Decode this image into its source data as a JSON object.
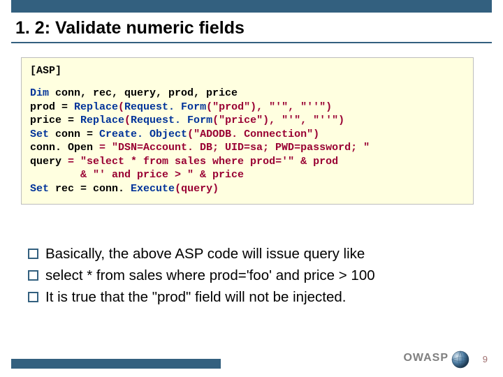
{
  "title": "1. 2: Validate numeric fields",
  "code_tag": "[ASP]",
  "code": {
    "l1": {
      "kw": "Dim ",
      "rest": "conn, rec, query, prod, price"
    },
    "l2": {
      "id": "prod = ",
      "fn": "Replace",
      "p1": "(",
      "fn2": "Request. Form",
      "p2": "(\"prod\"), \"'\", \"''\")"
    },
    "l3": {
      "id": "price = ",
      "fn": "Replace",
      "p1": "(",
      "fn2": "Request. Form",
      "p2": "(\"price\"), \"'\", \"''\")"
    },
    "l4": {
      "kw": "Set ",
      "id": "conn = ",
      "fn": "Create. Object",
      "p": "(\"ADODB. Connection\")"
    },
    "l5": {
      "id": "conn. Open",
      "p": " = \"DSN=Account. DB; UID=sa; PWD=password; \""
    },
    "l6": {
      "id": "query",
      "p": " = \"select * from sales where prod='\" & prod"
    },
    "l7": {
      "p": "        & \"' and price > \" & price"
    },
    "l8": {
      "kw": "Set ",
      "id": "rec = conn. ",
      "fn": "Execute",
      "p": "(query)"
    }
  },
  "bullets": [
    "Basically, the above ASP code will issue query like",
    "select * from sales where prod='foo' and price > 100",
    "It is true that the \"prod\" field will not be injected."
  ],
  "footer": {
    "brand": "OWASP",
    "page": "9"
  }
}
